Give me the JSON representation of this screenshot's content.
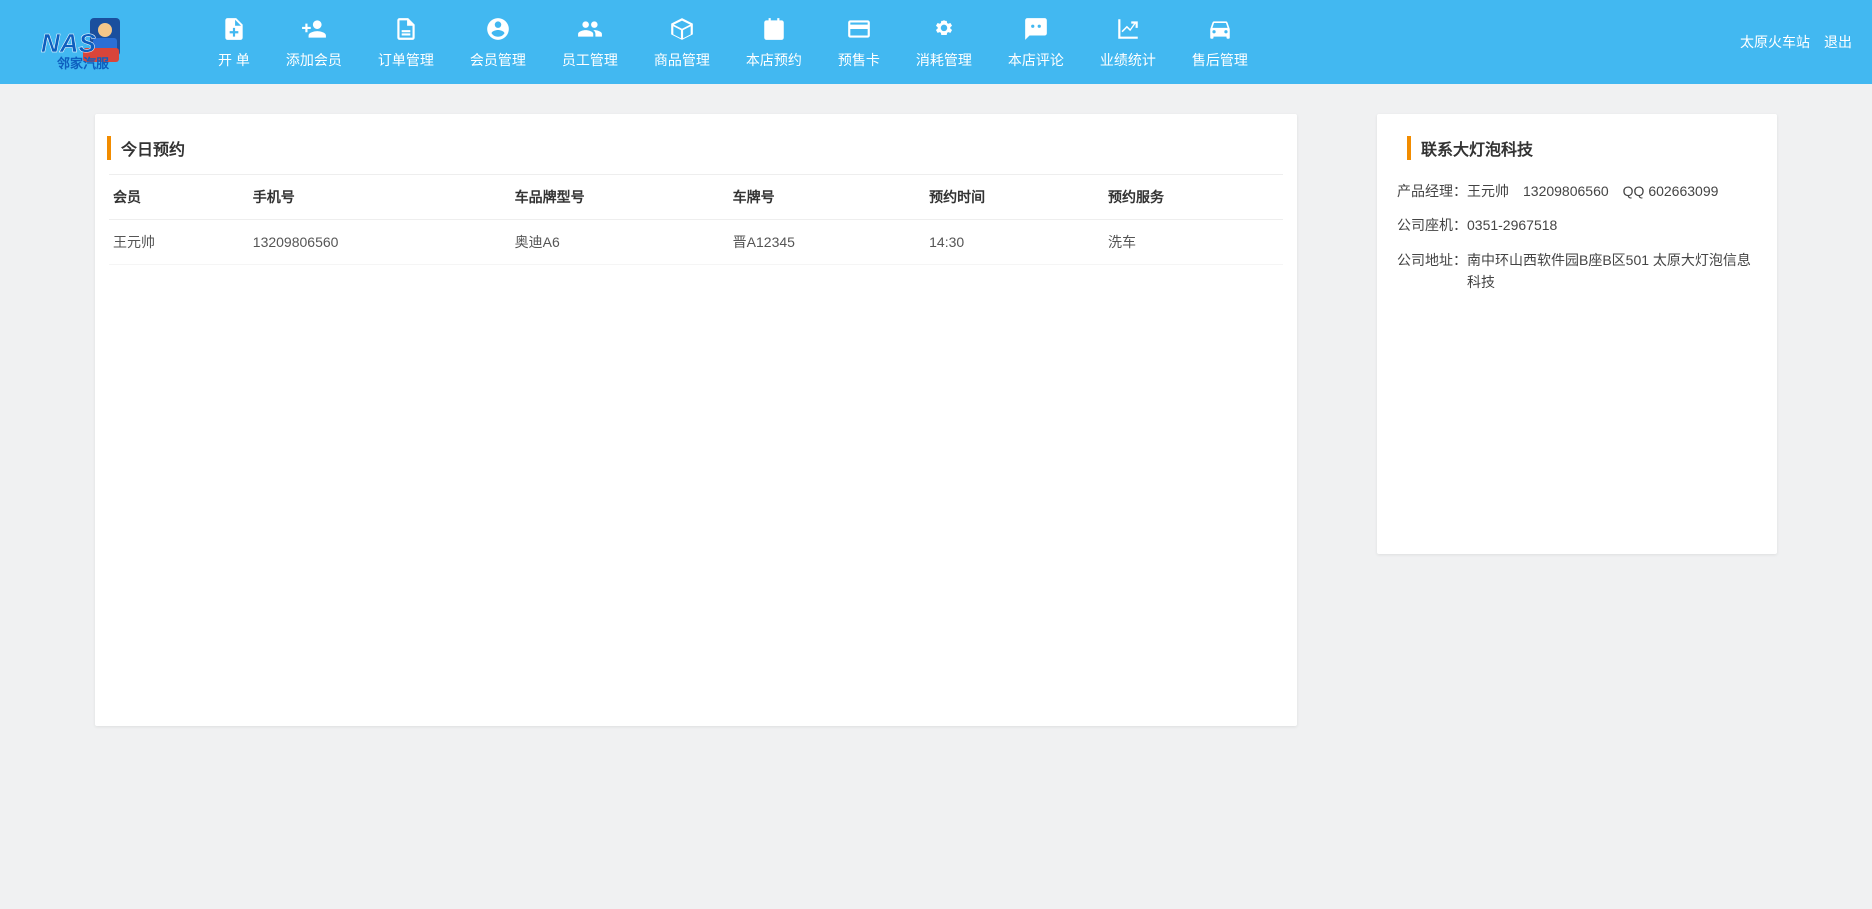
{
  "header": {
    "station": "太原火车站",
    "logout": "退出"
  },
  "nav": [
    {
      "label": "开 单",
      "icon": "file-plus-icon"
    },
    {
      "label": "添加会员",
      "icon": "user-plus-icon"
    },
    {
      "label": "订单管理",
      "icon": "order-icon"
    },
    {
      "label": "会员管理",
      "icon": "member-icon"
    },
    {
      "label": "员工管理",
      "icon": "staff-icon"
    },
    {
      "label": "商品管理",
      "icon": "product-icon"
    },
    {
      "label": "本店预约",
      "icon": "reservation-icon"
    },
    {
      "label": "预售卡",
      "icon": "card-icon"
    },
    {
      "label": "消耗管理",
      "icon": "consume-icon"
    },
    {
      "label": "本店评论",
      "icon": "comment-icon"
    },
    {
      "label": "业绩统计",
      "icon": "stats-icon"
    },
    {
      "label": "售后管理",
      "icon": "aftersale-icon"
    }
  ],
  "appointments": {
    "title": "今日预约",
    "columns": [
      "会员",
      "手机号",
      "车品牌型号",
      "车牌号",
      "预约时间",
      "预约服务"
    ],
    "rows": [
      {
        "member": "王元帅",
        "phone": "13209806560",
        "car_model": "奥迪A6",
        "plate": "晋A12345",
        "time": "14:30",
        "service": "洗车"
      }
    ]
  },
  "contact": {
    "title": "联系大灯泡科技",
    "product_manager_label": "产品经理：",
    "product_manager_value": "王元帅　13209806560　QQ 602663099",
    "company_phone_label": "公司座机：",
    "company_phone_value": "0351-2967518",
    "company_address_label": "公司地址：",
    "company_address_value": "南中环山西软件园B座B区501 太原大灯泡信息科技"
  }
}
